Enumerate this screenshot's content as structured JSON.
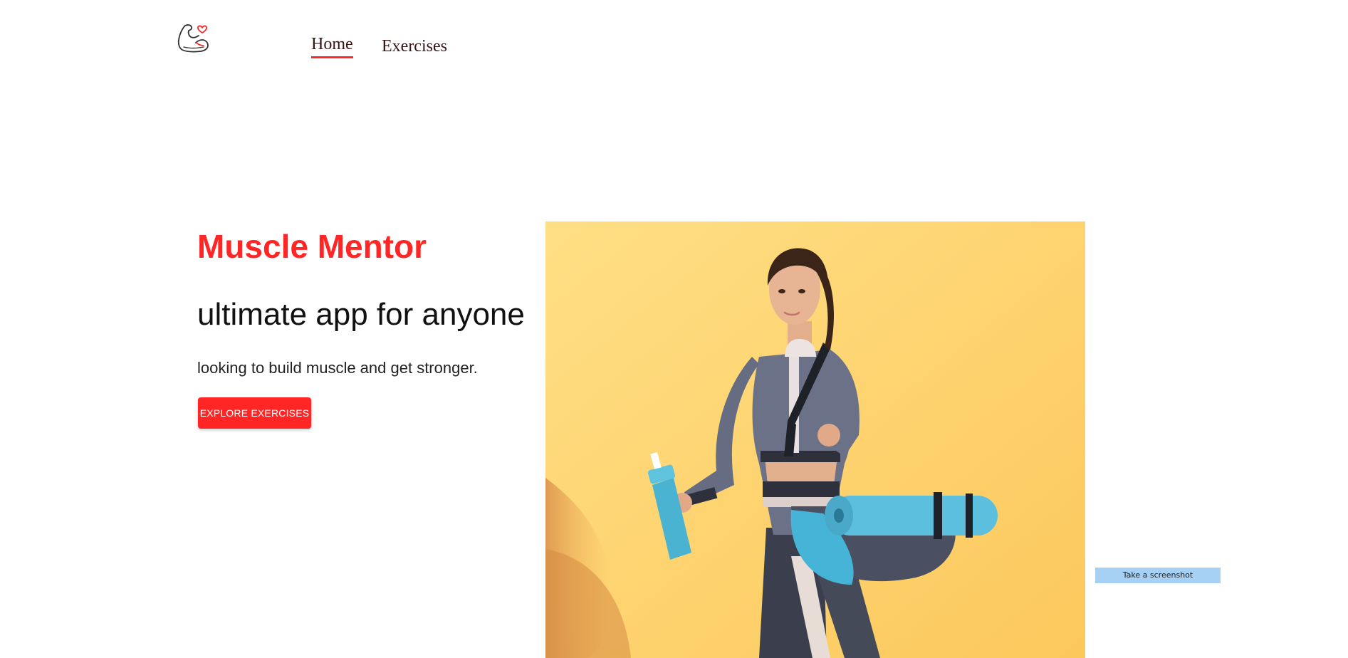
{
  "nav": {
    "logo_icon": "flexed-arm-heart-icon",
    "home_label": "Home",
    "exercises_label": "Exercises"
  },
  "hero": {
    "title": "Muscle Mentor",
    "subtitle": "ultimate app for anyone",
    "description": "looking to build muscle and get stronger.",
    "cta_label": "EXPLORE EXERCISES",
    "image_icon": "woman-with-gym-bag-image"
  },
  "overlay": {
    "screenshot_label": "Take a screenshot"
  },
  "colors": {
    "accent": "#ff2625",
    "hero_bg": "#ffd36a",
    "text": "#111111",
    "screenshot_bg": "#a6d1f5"
  }
}
